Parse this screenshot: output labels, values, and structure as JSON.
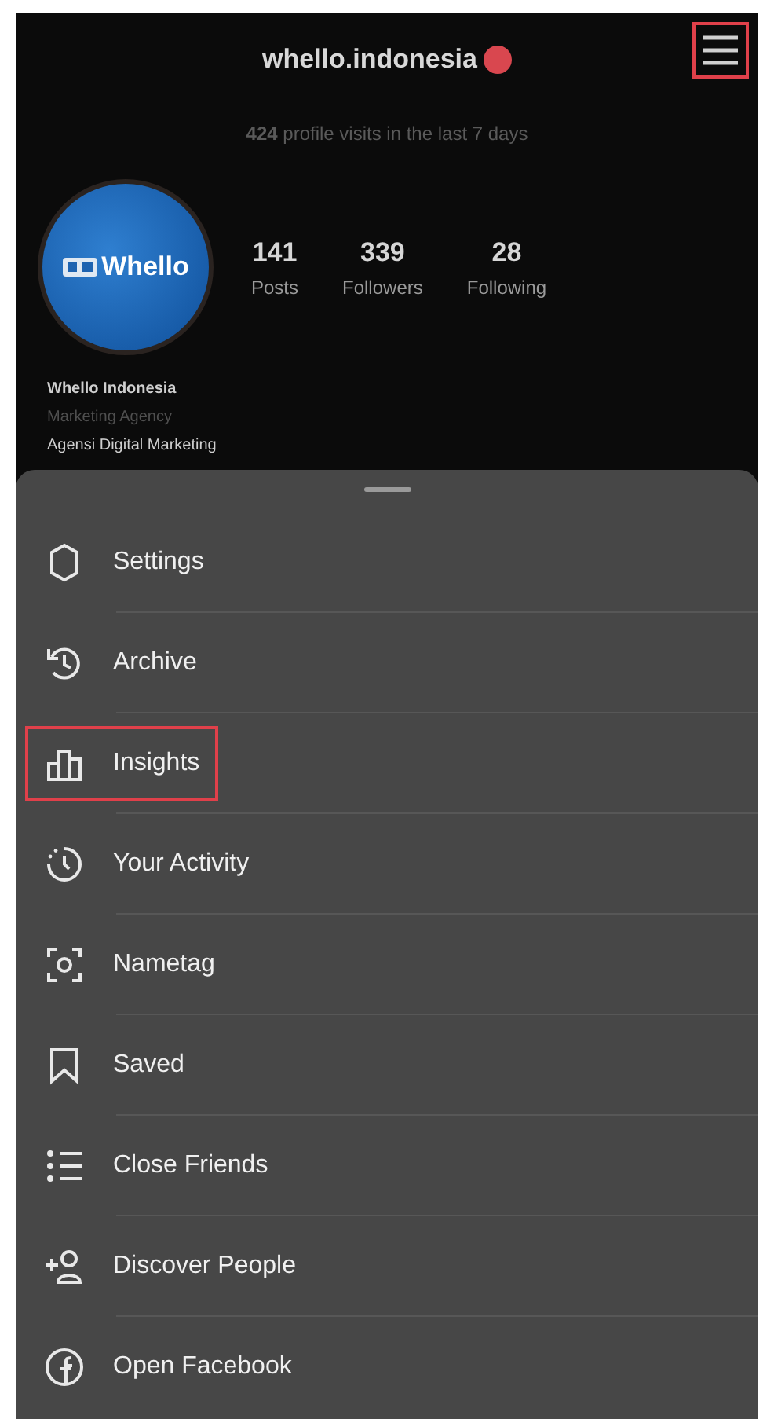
{
  "header": {
    "username": "whello.indonesia",
    "notification_badge": true,
    "menu_button": {
      "highlighted": true
    }
  },
  "visits": "**424** profile visits in the last 7 days",
  "profile": {
    "avatar_text": "Whello",
    "stats": [
      {
        "value": "141",
        "label": "Posts"
      },
      {
        "value": "339",
        "label": "Followers"
      },
      {
        "value": "28",
        "label": "Following"
      }
    ],
    "name": "Whello Indonesia",
    "category": "Marketing Agency",
    "bio": "Agensi Digital Marketing"
  },
  "menu": [
    {
      "label": "Settings",
      "highlighted": false
    },
    {
      "label": "Archive",
      "highlighted": false
    },
    {
      "label": "Insights",
      "highlighted": true
    },
    {
      "label": "Your Activity",
      "highlighted": false
    },
    {
      "label": "Nametag",
      "highlighted": false
    },
    {
      "label": "Saved",
      "highlighted": false
    },
    {
      "label": "Close Friends",
      "highlighted": false
    },
    {
      "label": "Discover People",
      "highlighted": false
    },
    {
      "label": "Open Facebook",
      "highlighted": false
    }
  ]
}
